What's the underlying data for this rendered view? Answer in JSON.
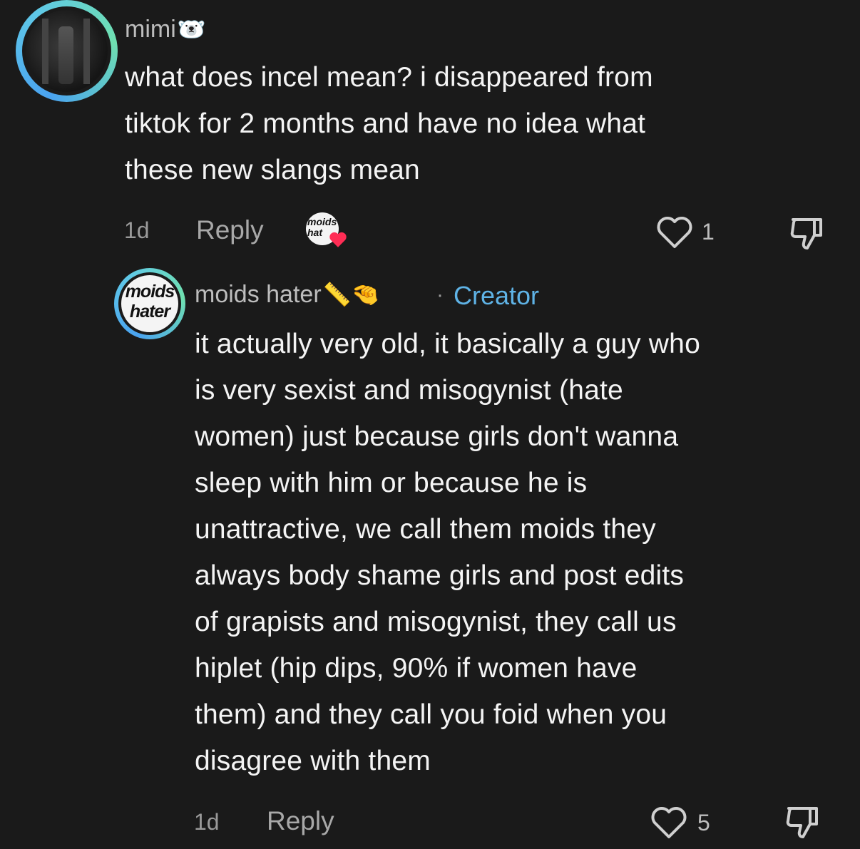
{
  "comments": [
    {
      "username": "mimi",
      "username_emoji": "🐻‍❄️",
      "text_lines": [
        "what does incel mean? i disappeared from",
        "tiktok for 2 months and have no idea what",
        "these new slangs mean"
      ],
      "time": "1d",
      "reply_label": "Reply",
      "like_count": "1",
      "creator_liked_badge_text": "moids hat"
    },
    {
      "username": "moids hater",
      "username_emoji": "📏🤏",
      "separator": "·",
      "creator_label": "Creator",
      "avatar_text_top": "moids",
      "avatar_text_bottom": "hater",
      "text_lines": [
        "it actually very old, it basically a guy who",
        "is very sexist and misogynist (hate",
        "women) just because girls don't wanna",
        "sleep with him or because he is",
        "unattractive, we call them moids they",
        "always body shame girls and post edits",
        "of grapists and misogynist, they call us",
        "hiplet (hip dips, 90% if women have",
        "them) and they call you foid when you",
        "disagree with them"
      ],
      "time": "1d",
      "reply_label": "Reply",
      "like_count": "5"
    }
  ],
  "colors": {
    "background": "#1a1a1a",
    "creator_accent": "#5fb3e6",
    "avatar_ring_start": "#4aa3f0",
    "avatar_ring_end": "#6fe0b0",
    "heart_badge": "#ff2d55"
  },
  "icons": {
    "like": "heart-outline-icon",
    "dislike": "thumbs-down-outline-icon"
  }
}
